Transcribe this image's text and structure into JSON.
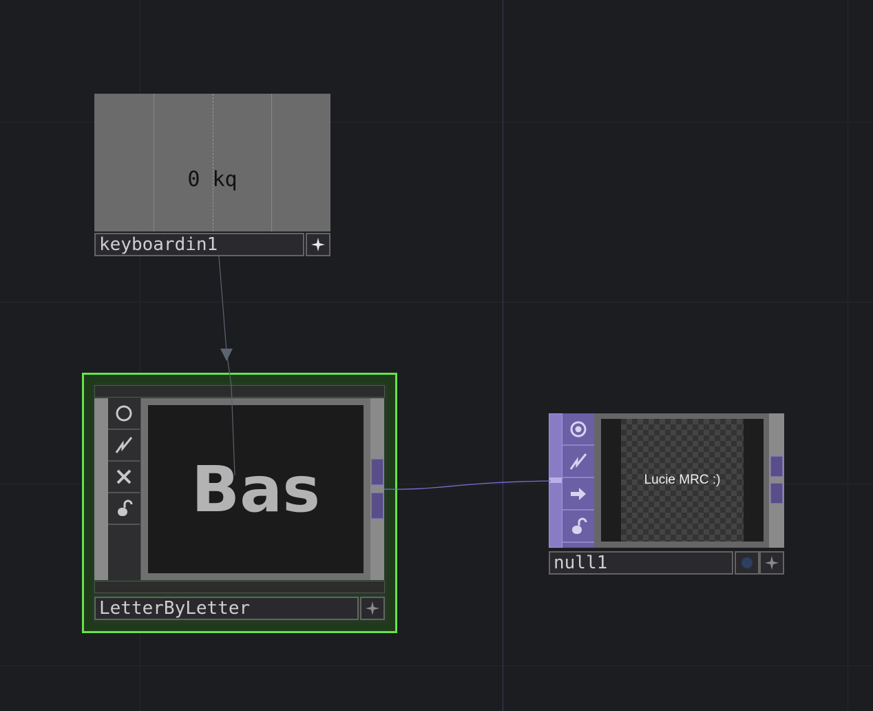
{
  "nodes": {
    "keyboardin1": {
      "name": "keyboardin1",
      "viewer_text": "0 kq",
      "action_icon": "sparkle-icon"
    },
    "letterbyletter": {
      "name": "LetterByLetter",
      "viewer_text": "Bas",
      "selected": true,
      "action_icon": "sparkle-icon",
      "tools": [
        "bypass-icon",
        "cook-icon",
        "delete-icon",
        "lock-icon"
      ]
    },
    "null1": {
      "name": "null1",
      "viewer_text": "Lucie MRC :)",
      "action_icon": "sparkle-icon",
      "status_icon": "dot-icon",
      "tools": [
        "display-icon",
        "cook-icon",
        "export-icon",
        "lock-icon"
      ]
    }
  },
  "colors": {
    "background": "#1c1d21",
    "selection": "#66e34a",
    "dat_purple": "#6b5fa6",
    "wire_purple": "#7a6fd8",
    "wire_grey": "#5c6470"
  }
}
